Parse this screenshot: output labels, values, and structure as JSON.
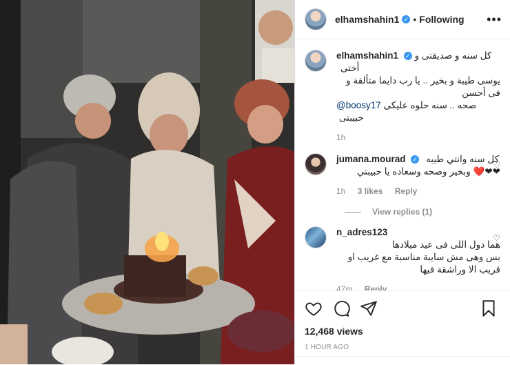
{
  "post": {
    "username": "elhamshahin1",
    "follow_status": "Following",
    "more_icon": "more-options-icon",
    "caption": {
      "username": "elhamshahin1",
      "line1": "كل سنه و صديقتى و أختى",
      "line2": "يوسى طيبة و بخير .. يا رب دايما متألقة و فى أحسن",
      "line3_mention": "@boosy17",
      "line3_text": "صحه .. سنه حلوه عليكى حبيبتى",
      "time": "1h"
    },
    "comments": [
      {
        "username": "jumana.mourad",
        "verified": true,
        "line1": "كل سنه وانتي طيبه",
        "line2": "❤❤❤️ وبخير وصحه وسعاده يا حبيبتي",
        "line3": "",
        "time": "1h",
        "likes": "3 likes",
        "reply_label": "Reply",
        "view_replies": "View replies (1)"
      },
      {
        "username": "n_adres123",
        "verified": false,
        "line1": "هما دول اللى فى عيد ميلادها",
        "line2": "بس وهى مش سايبة مناسبة مع غريب او",
        "line3": "قريب الا وراشقة فيها",
        "time": "47m",
        "reply_label": "Reply"
      }
    ],
    "views": "12,468 views",
    "posted_ago": "1 HOUR AGO"
  },
  "icons": {
    "like": "heart-icon",
    "comment": "comment-icon",
    "share": "share-icon",
    "save": "bookmark-icon"
  },
  "colors": {
    "verified": "#3897f0",
    "text": "#262626",
    "secondary": "#8e8e8e",
    "border": "#dbdbdb"
  }
}
